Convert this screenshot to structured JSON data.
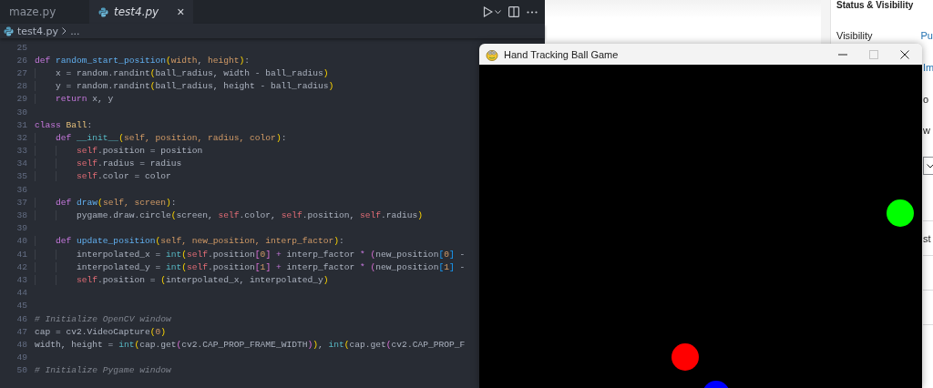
{
  "editor": {
    "tabs": [
      {
        "label": "maze.py",
        "selected": false
      },
      {
        "label": "test4.py",
        "selected": true,
        "close": "×"
      }
    ],
    "breadcrumb": {
      "file": "test4.py",
      "rest": "..."
    },
    "lines": [
      {
        "number": "25"
      },
      {
        "number": "26",
        "tokens": [
          {
            "kind": "keyword",
            "text": "def"
          },
          {
            "kind": "function",
            "text": " random_start_position"
          },
          {
            "kind": "bracket1",
            "text": "("
          },
          {
            "kind": "param",
            "text": "width"
          },
          {
            "kind": "plain",
            "text": ", "
          },
          {
            "kind": "param",
            "text": "height"
          },
          {
            "kind": "bracket1",
            "text": ")"
          },
          {
            "kind": "plain",
            "text": ":"
          }
        ]
      },
      {
        "number": "27",
        "tokens": [
          {
            "kind": "indent"
          },
          {
            "kind": "plain",
            "text": "x = random.randint"
          },
          {
            "kind": "bracket1",
            "text": "("
          },
          {
            "kind": "plain",
            "text": "ball_radius, width - ball_radius"
          },
          {
            "kind": "bracket1",
            "text": ")"
          }
        ]
      },
      {
        "number": "28",
        "tokens": [
          {
            "kind": "indent"
          },
          {
            "kind": "plain",
            "text": "y = random.randint"
          },
          {
            "kind": "bracket1",
            "text": "("
          },
          {
            "kind": "plain",
            "text": "ball_radius, height - ball_radius"
          },
          {
            "kind": "bracket1",
            "text": ")"
          }
        ]
      },
      {
        "number": "29",
        "tokens": [
          {
            "kind": "indent"
          },
          {
            "kind": "keyword",
            "text": "return"
          },
          {
            "kind": "plain",
            "text": " x, y"
          }
        ]
      },
      {
        "number": "30"
      },
      {
        "number": "31",
        "tokens": [
          {
            "kind": "keyword",
            "text": "class"
          },
          {
            "kind": "class",
            "text": " Ball"
          },
          {
            "kind": "plain",
            "text": ":"
          }
        ]
      },
      {
        "number": "32",
        "tokens": [
          {
            "kind": "indent"
          },
          {
            "kind": "keyword",
            "text": "def"
          },
          {
            "kind": "builtin",
            "text": " __init__"
          },
          {
            "kind": "bracket1",
            "text": "("
          },
          {
            "kind": "param",
            "text": "self, position, radius, color"
          },
          {
            "kind": "bracket1",
            "text": ")"
          },
          {
            "kind": "plain",
            "text": ":"
          }
        ]
      },
      {
        "number": "33",
        "tokens": [
          {
            "kind": "indent"
          },
          {
            "kind": "indent"
          },
          {
            "kind": "self",
            "text": "self"
          },
          {
            "kind": "plain",
            "text": ".position = position"
          }
        ]
      },
      {
        "number": "34",
        "tokens": [
          {
            "kind": "indent"
          },
          {
            "kind": "indent"
          },
          {
            "kind": "self",
            "text": "self"
          },
          {
            "kind": "plain",
            "text": ".radius = radius"
          }
        ]
      },
      {
        "number": "35",
        "tokens": [
          {
            "kind": "indent"
          },
          {
            "kind": "indent"
          },
          {
            "kind": "self",
            "text": "self"
          },
          {
            "kind": "plain",
            "text": ".color = color"
          }
        ]
      },
      {
        "number": "36"
      },
      {
        "number": "37",
        "tokens": [
          {
            "kind": "indent"
          },
          {
            "kind": "keyword",
            "text": "def"
          },
          {
            "kind": "function",
            "text": " draw"
          },
          {
            "kind": "bracket1",
            "text": "("
          },
          {
            "kind": "param",
            "text": "self, screen"
          },
          {
            "kind": "bracket1",
            "text": ")"
          },
          {
            "kind": "plain",
            "text": ":"
          }
        ]
      },
      {
        "number": "38",
        "tokens": [
          {
            "kind": "indent"
          },
          {
            "kind": "indent"
          },
          {
            "kind": "plain",
            "text": "pygame.draw.circle"
          },
          {
            "kind": "bracket1",
            "text": "("
          },
          {
            "kind": "plain",
            "text": "screen, "
          },
          {
            "kind": "self",
            "text": "self"
          },
          {
            "kind": "plain",
            "text": ".color, "
          },
          {
            "kind": "self",
            "text": "self"
          },
          {
            "kind": "plain",
            "text": ".position, "
          },
          {
            "kind": "self",
            "text": "self"
          },
          {
            "kind": "plain",
            "text": ".radius"
          },
          {
            "kind": "bracket1",
            "text": ")"
          }
        ]
      },
      {
        "number": "39"
      },
      {
        "number": "40",
        "tokens": [
          {
            "kind": "indent"
          },
          {
            "kind": "keyword",
            "text": "def"
          },
          {
            "kind": "function",
            "text": " update_position"
          },
          {
            "kind": "bracket1",
            "text": "("
          },
          {
            "kind": "param",
            "text": "self, new_position, interp_factor"
          },
          {
            "kind": "bracket1",
            "text": ")"
          },
          {
            "kind": "plain",
            "text": ":"
          }
        ]
      },
      {
        "number": "41",
        "tokens": [
          {
            "kind": "indent"
          },
          {
            "kind": "indent"
          },
          {
            "kind": "plain",
            "text": "interpolated_x = "
          },
          {
            "kind": "builtin",
            "text": "int"
          },
          {
            "kind": "bracket1",
            "text": "("
          },
          {
            "kind": "self",
            "text": "self"
          },
          {
            "kind": "plain",
            "text": ".position"
          },
          {
            "kind": "bracket2",
            "text": "["
          },
          {
            "kind": "number",
            "text": "0"
          },
          {
            "kind": "bracket2",
            "text": "]"
          },
          {
            "kind": "operator",
            "text": " +"
          },
          {
            "kind": "plain",
            "text": " interp_factor "
          },
          {
            "kind": "operator",
            "text": "*"
          },
          {
            "kind": "bracket2",
            "text": " ("
          },
          {
            "kind": "plain",
            "text": "new_position"
          },
          {
            "kind": "bracket3",
            "text": "["
          },
          {
            "kind": "number",
            "text": "0"
          },
          {
            "kind": "bracket3",
            "text": "]"
          },
          {
            "kind": "plain",
            "text": " -"
          }
        ]
      },
      {
        "number": "42",
        "tokens": [
          {
            "kind": "indent"
          },
          {
            "kind": "indent"
          },
          {
            "kind": "plain",
            "text": "interpolated_y = "
          },
          {
            "kind": "builtin",
            "text": "int"
          },
          {
            "kind": "bracket1",
            "text": "("
          },
          {
            "kind": "self",
            "text": "self"
          },
          {
            "kind": "plain",
            "text": ".position"
          },
          {
            "kind": "bracket2",
            "text": "["
          },
          {
            "kind": "number",
            "text": "1"
          },
          {
            "kind": "bracket2",
            "text": "]"
          },
          {
            "kind": "operator",
            "text": " +"
          },
          {
            "kind": "plain",
            "text": " interp_factor "
          },
          {
            "kind": "operator",
            "text": "*"
          },
          {
            "kind": "bracket2",
            "text": " ("
          },
          {
            "kind": "plain",
            "text": "new_position"
          },
          {
            "kind": "bracket3",
            "text": "["
          },
          {
            "kind": "number",
            "text": "1"
          },
          {
            "kind": "bracket3",
            "text": "]"
          },
          {
            "kind": "plain",
            "text": " -"
          }
        ]
      },
      {
        "number": "43",
        "tokens": [
          {
            "kind": "indent"
          },
          {
            "kind": "indent"
          },
          {
            "kind": "self",
            "text": "self"
          },
          {
            "kind": "plain",
            "text": ".position = "
          },
          {
            "kind": "bracket1",
            "text": "("
          },
          {
            "kind": "plain",
            "text": "interpolated_x, interpolated_y"
          },
          {
            "kind": "bracket1",
            "text": ")"
          }
        ]
      },
      {
        "number": "44"
      },
      {
        "number": "45"
      },
      {
        "number": "46",
        "tokens": [
          {
            "kind": "comment",
            "text": "# Initialize OpenCV window"
          }
        ]
      },
      {
        "number": "47",
        "tokens": [
          {
            "kind": "plain",
            "text": "cap = cv2.VideoCapture"
          },
          {
            "kind": "bracket1",
            "text": "("
          },
          {
            "kind": "number",
            "text": "0"
          },
          {
            "kind": "bracket1",
            "text": ")"
          }
        ]
      },
      {
        "number": "48",
        "tokens": [
          {
            "kind": "plain",
            "text": "width, height = "
          },
          {
            "kind": "builtin",
            "text": "int"
          },
          {
            "kind": "bracket1",
            "text": "("
          },
          {
            "kind": "plain",
            "text": "cap.get"
          },
          {
            "kind": "bracket2",
            "text": "("
          },
          {
            "kind": "plain",
            "text": "cv2.CAP_PROP_FRAME_WIDTH"
          },
          {
            "kind": "bracket2",
            "text": ")"
          },
          {
            "kind": "bracket1",
            "text": ")"
          },
          {
            "kind": "plain",
            "text": ", "
          },
          {
            "kind": "builtin",
            "text": "int"
          },
          {
            "kind": "bracket1",
            "text": "("
          },
          {
            "kind": "plain",
            "text": "cap.get"
          },
          {
            "kind": "bracket2",
            "text": "("
          },
          {
            "kind": "plain",
            "text": "cv2.CAP_PROP_F"
          }
        ]
      },
      {
        "number": "49"
      },
      {
        "number": "50",
        "tokens": [
          {
            "kind": "comment",
            "text": "# Initialize Pygame window"
          }
        ]
      }
    ]
  },
  "settings_panel": {
    "heading": "Status & Visibility",
    "visibility_label": "Visibility",
    "visibility_value": "Pu",
    "value_2": "Im",
    "text_3": "o",
    "text_4": "w",
    "text_5": "st"
  },
  "game_window": {
    "title": "Hand Tracking Ball Game",
    "balls": [
      {
        "color": "#00ff00"
      },
      {
        "color": "#ff0000"
      },
      {
        "color": "#0000ff"
      }
    ]
  }
}
